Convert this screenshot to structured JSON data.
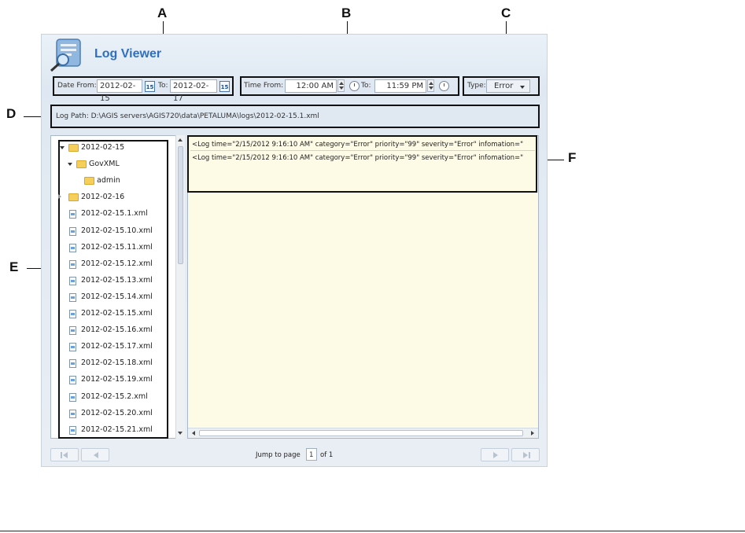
{
  "callouts": {
    "a": "A",
    "b": "B",
    "c": "C",
    "d": "D",
    "e": "E",
    "f": "F"
  },
  "app": {
    "title": "Log Viewer"
  },
  "date_filter": {
    "from_label": "Date From:",
    "from_value": "2012-02-15",
    "to_label": "To:",
    "to_value": "2012-02-17",
    "calendar_glyph": "15"
  },
  "time_filter": {
    "from_label": "Time From:",
    "from_value": "12:00 AM",
    "to_label": "To:",
    "to_value": "11:59 PM"
  },
  "type_filter": {
    "label": "Type:",
    "value": "Error"
  },
  "log_path": {
    "text": "Log Path: D:\\AGIS servers\\AGIS720\\data\\PETALUMA\\logs\\2012-02-15.1.xml"
  },
  "tree": [
    {
      "label": "2012-02-15",
      "kind": "folder",
      "indent": 0,
      "expander": "expanded"
    },
    {
      "label": "GovXML",
      "kind": "folder",
      "indent": 1,
      "expander": "expanded"
    },
    {
      "label": "admin",
      "kind": "folder",
      "indent": 2,
      "expander": "none"
    },
    {
      "label": "2012-02-16",
      "kind": "folder",
      "indent": 0,
      "expander": "collapsed"
    },
    {
      "label": "2012-02-15.1.xml",
      "kind": "file",
      "indent": 0
    },
    {
      "label": "2012-02-15.10.xml",
      "kind": "file",
      "indent": 0
    },
    {
      "label": "2012-02-15.11.xml",
      "kind": "file",
      "indent": 0
    },
    {
      "label": "2012-02-15.12.xml",
      "kind": "file",
      "indent": 0
    },
    {
      "label": "2012-02-15.13.xml",
      "kind": "file",
      "indent": 0
    },
    {
      "label": "2012-02-15.14.xml",
      "kind": "file",
      "indent": 0
    },
    {
      "label": "2012-02-15.15.xml",
      "kind": "file",
      "indent": 0
    },
    {
      "label": "2012-02-15.16.xml",
      "kind": "file",
      "indent": 0
    },
    {
      "label": "2012-02-15.17.xml",
      "kind": "file",
      "indent": 0
    },
    {
      "label": "2012-02-15.18.xml",
      "kind": "file",
      "indent": 0
    },
    {
      "label": "2012-02-15.19.xml",
      "kind": "file",
      "indent": 0
    },
    {
      "label": "2012-02-15.2.xml",
      "kind": "file",
      "indent": 0
    },
    {
      "label": "2012-02-15.20.xml",
      "kind": "file",
      "indent": 0
    },
    {
      "label": "2012-02-15.21.xml",
      "kind": "file",
      "indent": 0
    }
  ],
  "log_entries": [
    "<Log time=\"2/15/2012 9:16:10 AM\" category=\"Error\" priority=\"99\" severity=\"Error\" infomation=\"",
    "<Log time=\"2/15/2012 9:16:10 AM\" category=\"Error\" priority=\"99\" severity=\"Error\" infomation=\""
  ],
  "pager": {
    "jump_label": "Jump to page",
    "page": "1",
    "of_label": "of 1"
  },
  "colors": {
    "title_blue": "#2f6fc1",
    "log_bg": "#fdfbe6",
    "folder": "#f5cf5a"
  }
}
